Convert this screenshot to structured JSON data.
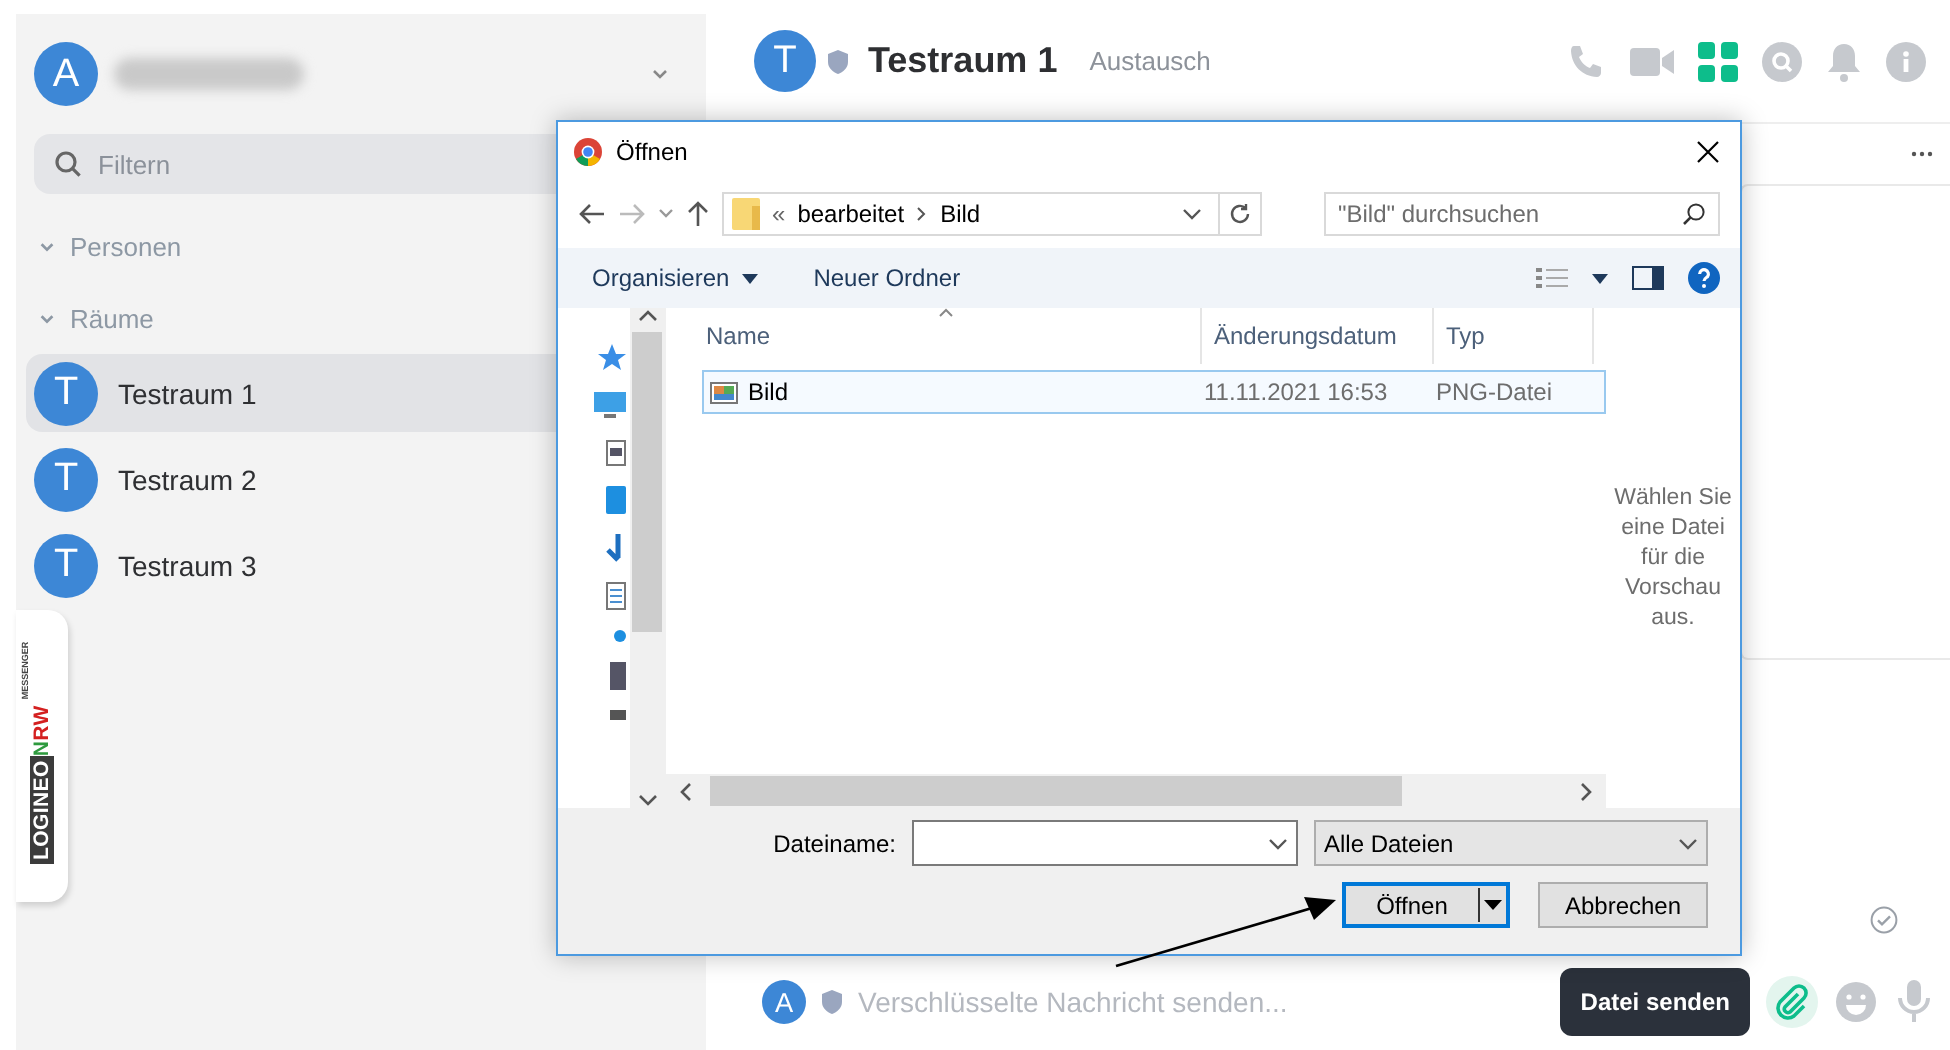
{
  "sidebar": {
    "user_avatar": "A",
    "filter": {
      "placeholder": "Filtern"
    },
    "sections": [
      {
        "label": "Personen",
        "expanded": true
      },
      {
        "label": "Räume",
        "expanded": true
      }
    ],
    "rooms": [
      {
        "avatar": "T",
        "name": "Testraum 1",
        "selected": true
      },
      {
        "avatar": "T",
        "name": "Testraum 2",
        "selected": false
      },
      {
        "avatar": "T",
        "name": "Testraum 3",
        "selected": false
      }
    ],
    "logo": {
      "parts": [
        {
          "text": "LOGINEO",
          "kind": "inverse"
        },
        {
          "text": "N",
          "kind": "green"
        },
        {
          "text": "RW",
          "kind": "red"
        }
      ],
      "sub": "MESSENGER"
    }
  },
  "room_header": {
    "avatar": "T",
    "name": "Testraum 1",
    "topic": "Austausch"
  },
  "composer": {
    "avatar": "A",
    "placeholder": "Verschlüsselte Nachricht senden...",
    "tooltip": "Datei senden"
  },
  "dialog": {
    "title": "Öffnen",
    "breadcrumb_prefix": "«",
    "breadcrumb": [
      "bearbeitet",
      "Bild"
    ],
    "search": {
      "placeholder": "\"Bild\" durchsuchen"
    },
    "toolbar": [
      {
        "label": "Organisieren",
        "kind": "menu"
      },
      {
        "label": "Neuer Ordner",
        "kind": "plain"
      }
    ],
    "columns": [
      "Name",
      "Änderungsdatum",
      "Typ"
    ],
    "files": [
      {
        "name": "Bild",
        "date": "11.11.2021 16:53",
        "type": "PNG-Datei",
        "selected": true
      }
    ],
    "preview_hint": "Wählen Sie eine Datei für die Vorschau aus.",
    "filename_label": "Dateiname:",
    "file_filter": "Alle Dateien",
    "buttons": {
      "open": "Öffnen",
      "cancel": "Abbrechen"
    }
  }
}
